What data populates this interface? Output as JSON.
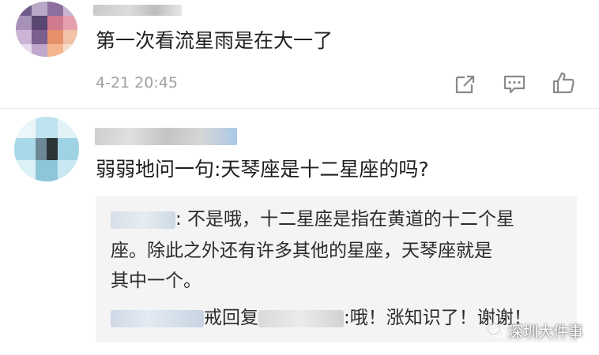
{
  "comments": [
    {
      "text": "第一次看流星雨是在大一了",
      "timestamp": "4-21 20:45",
      "actions": [
        "share-icon",
        "comment-icon",
        "like-icon"
      ]
    },
    {
      "text": "弱弱地问一句:天琴座是十二星座的吗?",
      "replies": [
        {
          "line1": ": 不是哦，十二星座是指在黄道的十二个星",
          "line2": "座。除此之外还有许多其他的星座，天琴座就是",
          "line3": "其中一个。"
        },
        {
          "mid": "戒回复",
          "tail": ":哦！涨知识了！谢谢！"
        }
      ]
    }
  ],
  "watermark": {
    "text": "深圳大件事",
    "icon": "wechat-logo-icon"
  },
  "colors": {
    "text": "#1f1f1f",
    "muted": "#a0a0a0",
    "reply_bg": "#f4f4f4",
    "divider": "#ececec"
  }
}
